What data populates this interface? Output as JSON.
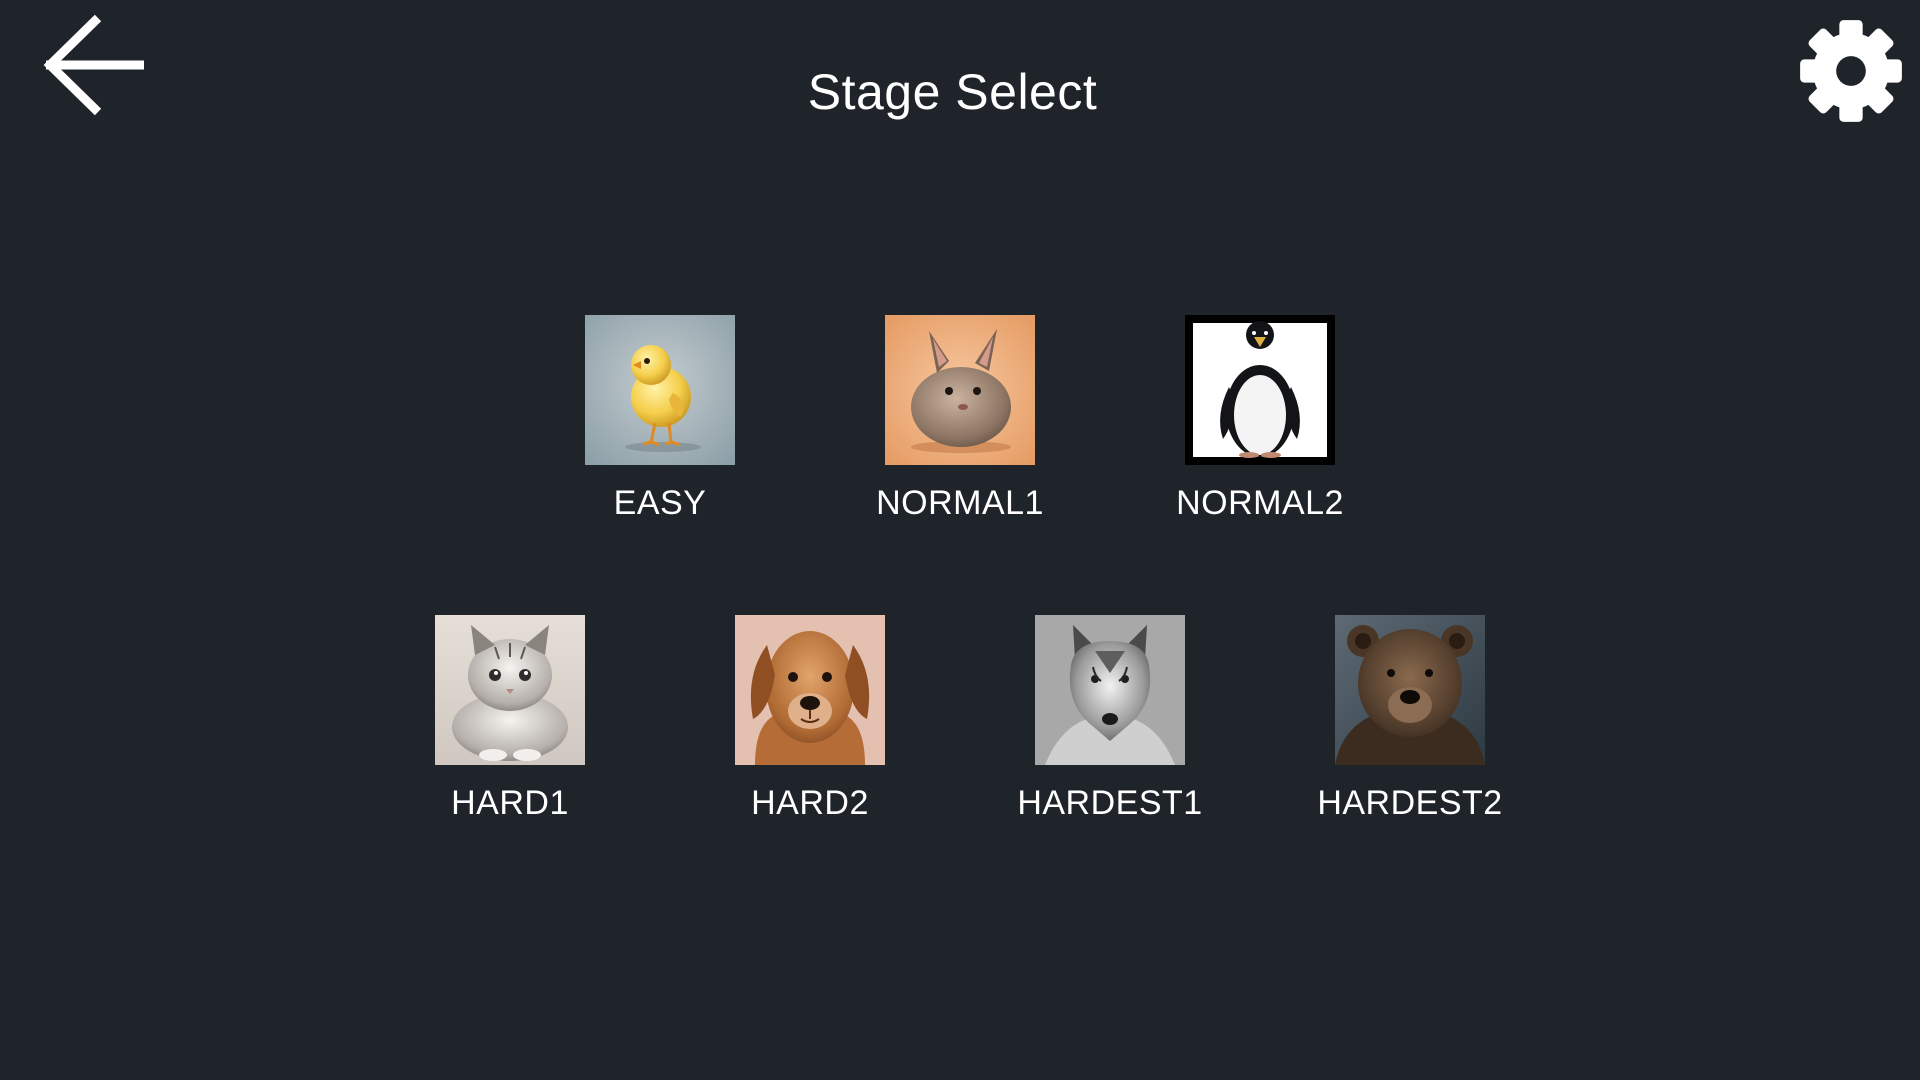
{
  "header": {
    "title": "Stage Select",
    "back_icon": "arrow-left-icon",
    "settings_icon": "gear-icon"
  },
  "colors": {
    "background": "#1f232a",
    "text": "#ffffff"
  },
  "stages": [
    {
      "label": "EASY",
      "image": "chick"
    },
    {
      "label": "NORMAL1",
      "image": "rabbit"
    },
    {
      "label": "NORMAL2",
      "image": "penguin"
    },
    {
      "label": "HARD1",
      "image": "cat"
    },
    {
      "label": "HARD2",
      "image": "dog"
    },
    {
      "label": "HARDEST1",
      "image": "wolf"
    },
    {
      "label": "HARDEST2",
      "image": "bear"
    }
  ]
}
